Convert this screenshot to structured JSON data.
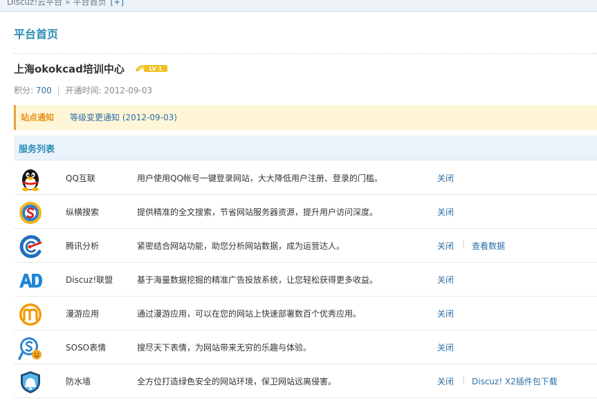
{
  "breadcrumb": {
    "part1": "Discuz!云平台",
    "separator": "»",
    "part2": "平台首页",
    "expand": "[+]"
  },
  "page_title": "平台首页",
  "site": {
    "name": "上海okokcad培训中心",
    "level_badge": "LV 1",
    "score_label": "积分:",
    "score": "700",
    "opened_label": "开通时间:",
    "opened_date": "2012-09-03"
  },
  "notice": {
    "label": "站点通知",
    "link": "等级变更通知 (2012-09-03)"
  },
  "services_title": "服务列表",
  "services": [
    {
      "icon": "qq-penguin-icon",
      "name": "QQ互联",
      "desc": "用户使用QQ帐号一键登录网站，大大降低用户注册、登录的门槛。",
      "action1": "关闭",
      "action2": ""
    },
    {
      "icon": "zongheng-search-icon",
      "name": "纵横搜索",
      "desc": "提供精准的全文搜索，节省网站服务器资源，提升用户访问深度。",
      "action1": "关闭",
      "action2": ""
    },
    {
      "icon": "tencent-analytics-icon",
      "name": "腾讯分析",
      "desc": "紧密结合网站功能，助您分析网站数据，成为运营达人。",
      "action1": "关闭",
      "action2": "查看数据"
    },
    {
      "icon": "ad-icon",
      "name": "Discuz!联盟",
      "desc": "基于海量数据挖掘的精准广告投放系统，让您轻松获得更多收益。",
      "action1": "关闭",
      "action2": ""
    },
    {
      "icon": "manyou-app-icon",
      "name": "漫游应用",
      "desc": "通过漫游应用，可以在您的网站上快速部署数百个优秀应用。",
      "action1": "关闭",
      "action2": ""
    },
    {
      "icon": "soso-emoticon-icon",
      "name": "SOSO表情",
      "desc": "搜尽天下表情，为网站带来无穷的乐趣与体验。",
      "action1": "关闭",
      "action2": ""
    },
    {
      "icon": "firewall-shield-icon",
      "name": "防水墙",
      "desc": "全方位打造绿色安全的网站环境，保卫网站远离侵害。",
      "action1": "关闭",
      "action2": "Discuz! X2插件包下载"
    }
  ],
  "colors": {
    "accent": "#2a8cb4",
    "link": "#2b6ea5",
    "notice_bg": "#fff6d7",
    "notice_label": "#e8921a"
  }
}
